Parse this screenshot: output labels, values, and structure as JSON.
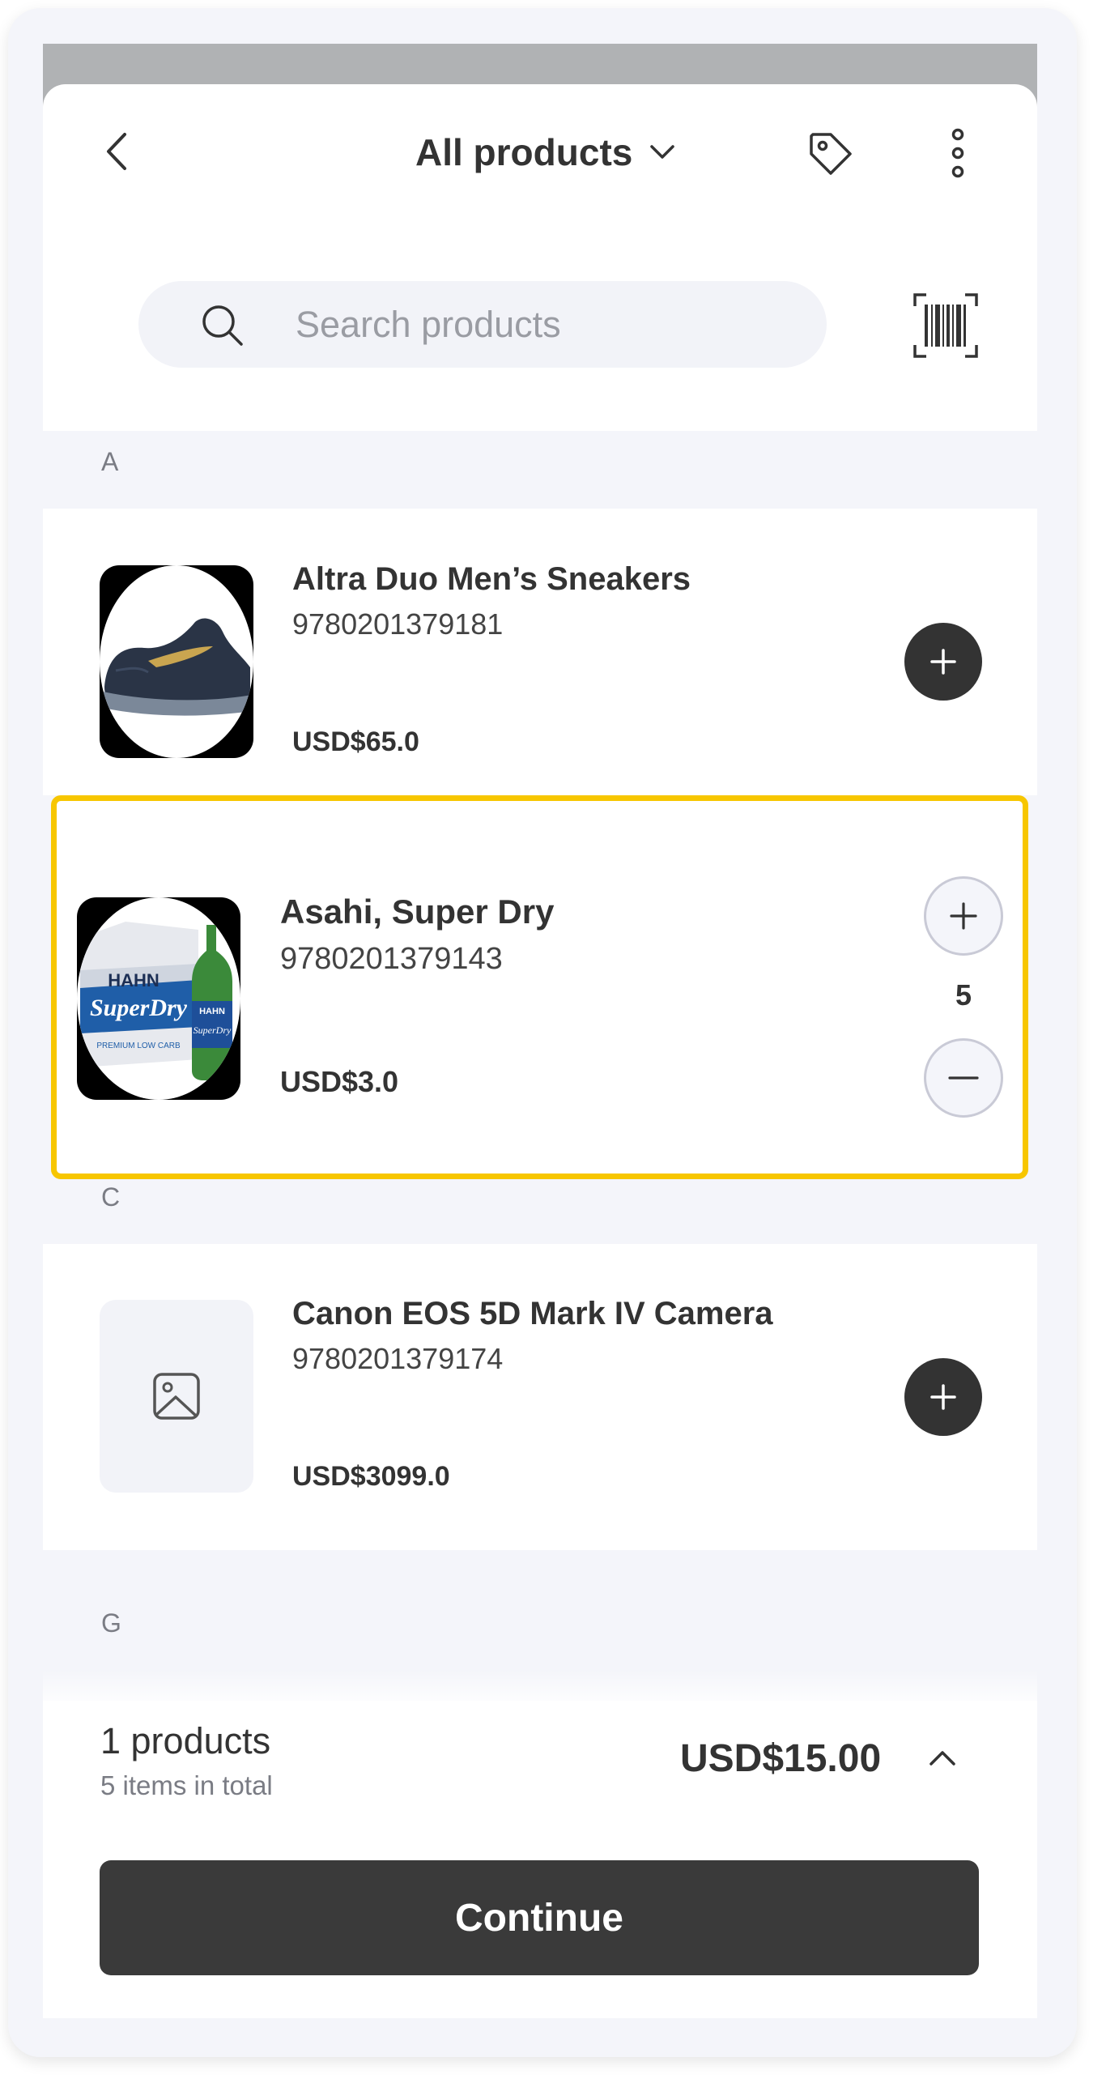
{
  "header": {
    "title": "All products"
  },
  "search": {
    "placeholder": "Search products"
  },
  "sections": [
    {
      "letter": "A",
      "products": [
        {
          "name": "Altra Duo Men’s Sneakers",
          "code": "9780201379181",
          "price": "USD$65.0"
        },
        {
          "name": "Asahi, Super Dry",
          "code": "9780201379143",
          "price": "USD$3.0",
          "quantity": "5",
          "selected": true,
          "package_brand_top": "HAHN",
          "package_brand_main": "SuperDry",
          "package_tagline": "PREMIUM LOW CARB",
          "bottle_label_top": "HAHN",
          "bottle_label_main": "SuperDry"
        }
      ]
    },
    {
      "letter": "C",
      "products": [
        {
          "name": "Canon EOS 5D Mark IV Camera",
          "code": "9780201379174",
          "price": "USD$3099.0",
          "image": "image-placeholder-icon"
        }
      ]
    },
    {
      "letter": "G",
      "products": []
    }
  ],
  "summary": {
    "products": "1 products",
    "items": "5 items in total",
    "total": "USD$15.00"
  },
  "continue_label": "Continue",
  "colors": {
    "accent_dark": "#333333",
    "selection_outline": "#f7c600",
    "background": "#f4f5fa"
  },
  "icons": [
    "chevron-left-icon",
    "chevron-down-icon",
    "tag-icon",
    "more-vertical-icon",
    "search-icon",
    "barcode-scan-icon",
    "plus-icon",
    "minus-icon",
    "image-placeholder-icon",
    "chevron-up-icon"
  ]
}
